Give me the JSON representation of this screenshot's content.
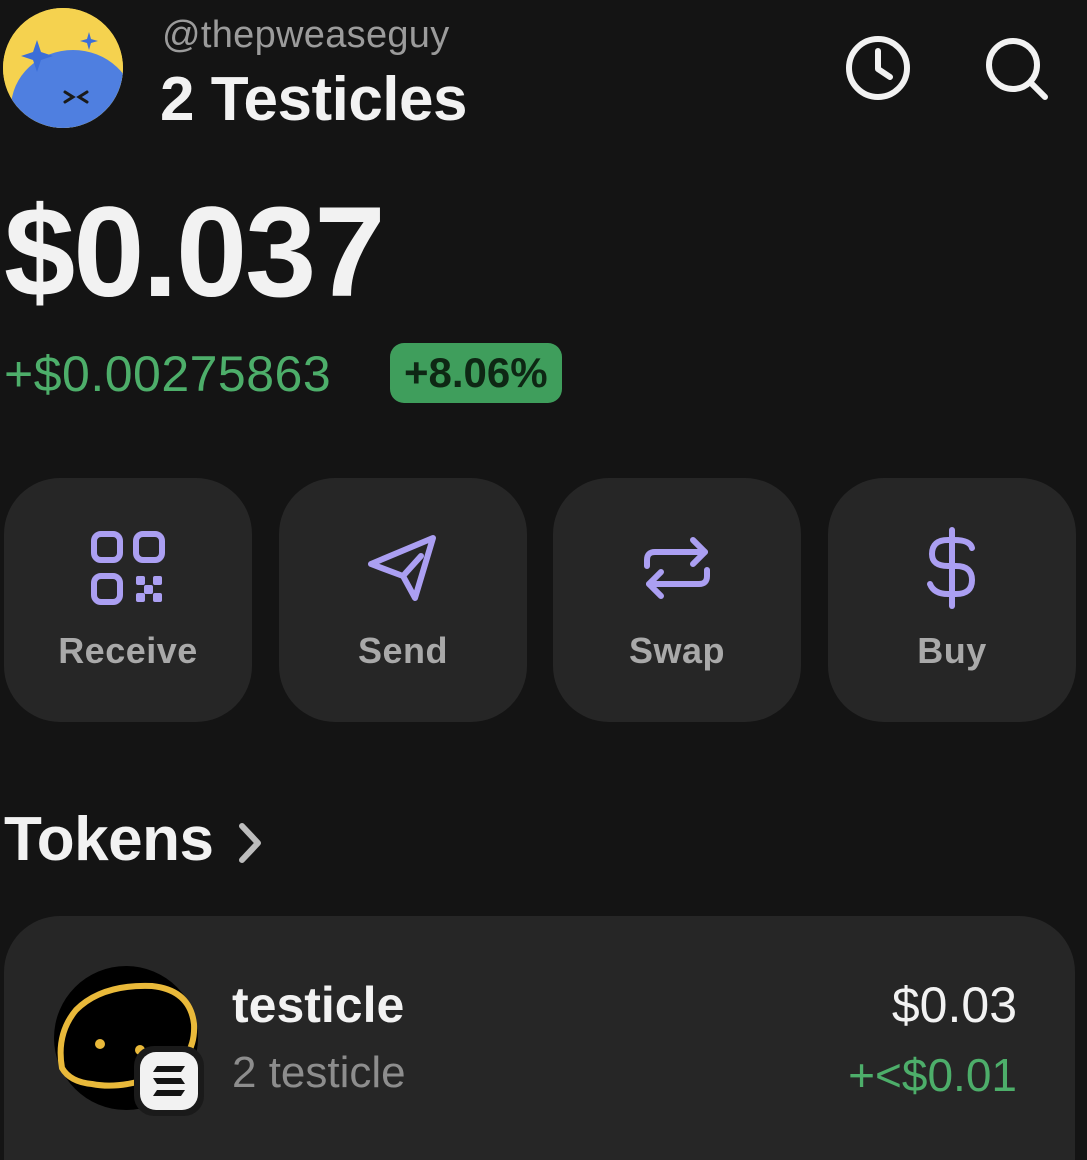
{
  "header": {
    "handle": "@thepweaseguy",
    "account_name": "2 Testicles",
    "avatar_icon": "avatar-icon",
    "history_icon": "clock-icon",
    "search_icon": "search-icon"
  },
  "balance": {
    "total": "$0.037",
    "change_amount": "+$0.00275863",
    "change_percent": "+8.06%"
  },
  "actions": [
    {
      "label": "Receive",
      "icon": "qr-code-icon"
    },
    {
      "label": "Send",
      "icon": "send-icon"
    },
    {
      "label": "Swap",
      "icon": "swap-icon"
    },
    {
      "label": "Buy",
      "icon": "dollar-icon"
    }
  ],
  "tokens": {
    "title": "Tokens",
    "items": [
      {
        "name": "testicle",
        "amount": "2 testicle",
        "value": "$0.03",
        "change": "+<$0.01",
        "chain_icon": "solana-icon"
      }
    ]
  },
  "colors": {
    "background": "#141414",
    "card": "#262626",
    "accent_purple": "#ab9ff2",
    "positive_green": "#4dae6a",
    "badge_green": "#3f9e5c"
  }
}
